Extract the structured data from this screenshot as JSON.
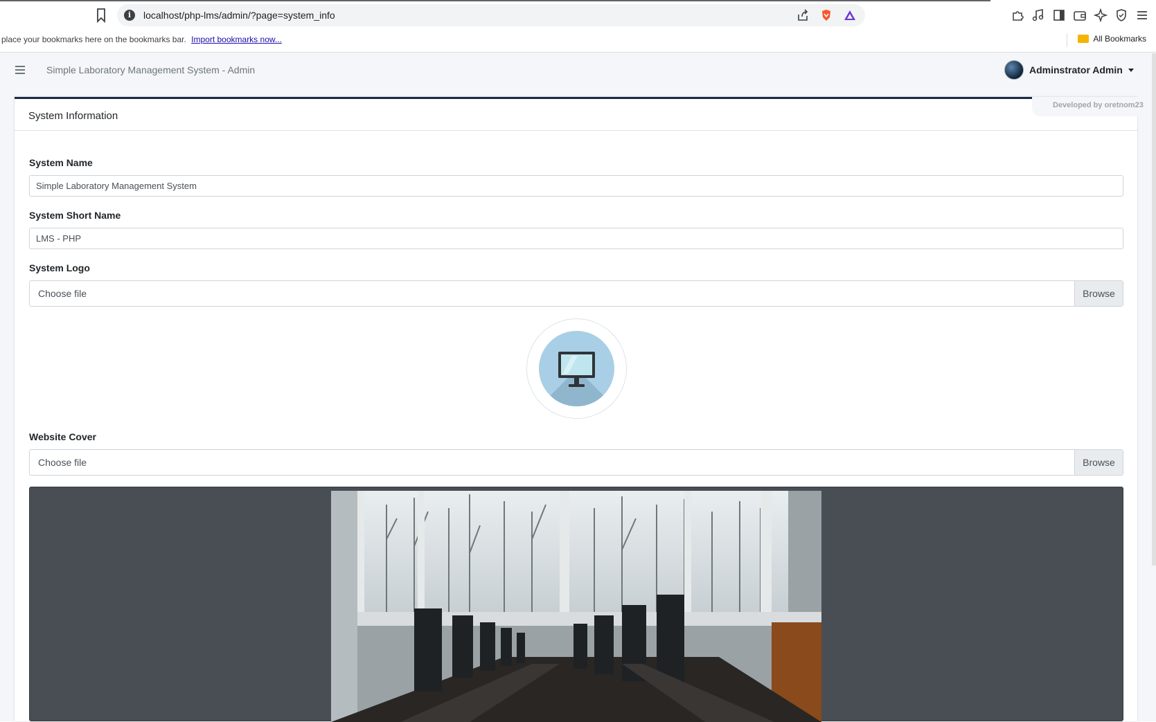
{
  "browser": {
    "url": "localhost/php-lms/admin/?page=system_info",
    "bookmarks_hint": "place your bookmarks here on the bookmarks bar.",
    "import_link": "Import bookmarks now...",
    "all_bookmarks": "All Bookmarks"
  },
  "navbar": {
    "app_title": "Simple Laboratory Management System - Admin",
    "user_name": "Adminstrator Admin"
  },
  "card": {
    "title": "System Information",
    "developer_badge": "Developed by oretnom23"
  },
  "form": {
    "system_name_label": "System Name",
    "system_name_value": "Simple Laboratory Management System",
    "short_name_label": "System Short Name",
    "short_name_value": "LMS - PHP",
    "logo_label": "System Logo",
    "logo_file_text": "Choose file",
    "logo_browse": "Browse",
    "cover_label": "Website Cover",
    "cover_file_text": "Choose file",
    "cover_browse": "Browse"
  },
  "colors": {
    "card_accent": "#1b2a45",
    "logo_circle": "#a9cfe6",
    "cover_frame": "#494e55"
  }
}
